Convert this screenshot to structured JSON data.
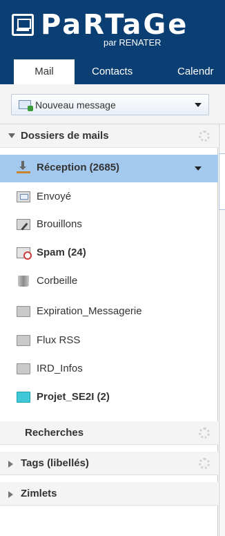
{
  "header": {
    "logo_text": "PaRTaGe",
    "logo_subtitle": "par RENATER",
    "tabs": [
      {
        "label": "Mail",
        "active": true
      },
      {
        "label": "Contacts",
        "active": false
      },
      {
        "label": "Calendr",
        "active": false
      }
    ]
  },
  "toolbar": {
    "new_message_label": "Nouveau message"
  },
  "sidebar": {
    "mail_folders_title": "Dossiers de mails",
    "folders": [
      {
        "label": "Réception (2685)",
        "icon": "inbox-icon",
        "selected": true,
        "bold": true
      },
      {
        "label": "Envoyé",
        "icon": "sent-icon",
        "selected": false,
        "bold": false
      },
      {
        "label": "Brouillons",
        "icon": "drafts-icon",
        "selected": false,
        "bold": false
      },
      {
        "label": "Spam (24)",
        "icon": "spam-icon",
        "selected": false,
        "bold": true
      },
      {
        "label": "Corbeille",
        "icon": "trash-icon",
        "selected": false,
        "bold": false
      },
      {
        "label": "Expiration_Messagerie",
        "icon": "folder-icon",
        "selected": false,
        "bold": false
      },
      {
        "label": "Flux RSS",
        "icon": "folder-icon",
        "selected": false,
        "bold": false
      },
      {
        "label": "IRD_Infos",
        "icon": "folder-icon",
        "selected": false,
        "bold": false
      },
      {
        "label": "Projet_SE2I (2)",
        "icon": "folder-cyan-icon",
        "selected": false,
        "bold": true
      }
    ],
    "searches_title": "Recherches",
    "tags_title": "Tags (libellés)",
    "zimlets_title": "Zimlets"
  },
  "colors": {
    "header_bg": "#0b3f73",
    "selected_bg": "#a3c9ef",
    "section_bg": "#f4f4f4"
  }
}
